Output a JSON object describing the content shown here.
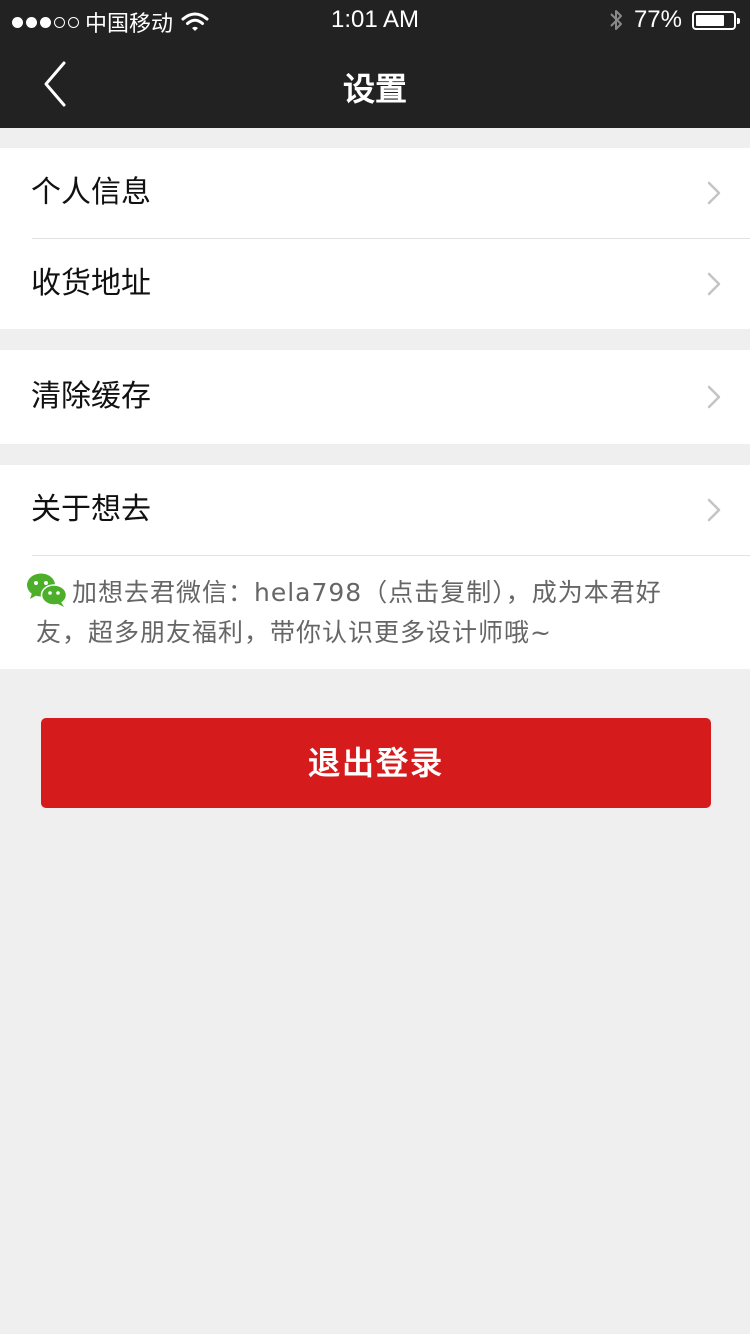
{
  "status_bar": {
    "carrier": "中国移动",
    "time": "1:01 AM",
    "battery_percent": "77%",
    "battery_level": 0.77,
    "signal_bars_filled": 3,
    "signal_bars_total": 5,
    "icons": [
      "wifi-icon",
      "bluetooth-icon",
      "battery-icon"
    ]
  },
  "nav": {
    "title": "设置",
    "back_icon": "chevron-left-icon"
  },
  "groups": [
    {
      "items": [
        {
          "label": "个人信息"
        },
        {
          "label": "收货地址"
        }
      ]
    },
    {
      "items": [
        {
          "label": "清除缓存"
        }
      ]
    },
    {
      "items": [
        {
          "label": "关于想去"
        }
      ]
    }
  ],
  "wechat_note": {
    "icon": "wechat-icon",
    "text": "加想去君微信：hela798（点击复制），成为本君好友，超多朋友福利，带你认识更多设计师哦~"
  },
  "logout": {
    "label": "退出登录"
  },
  "colors": {
    "nav_background": "#222222",
    "page_background": "#efefef",
    "logout_red": "#d61b1c",
    "wechat_green": "#4caf2a"
  }
}
